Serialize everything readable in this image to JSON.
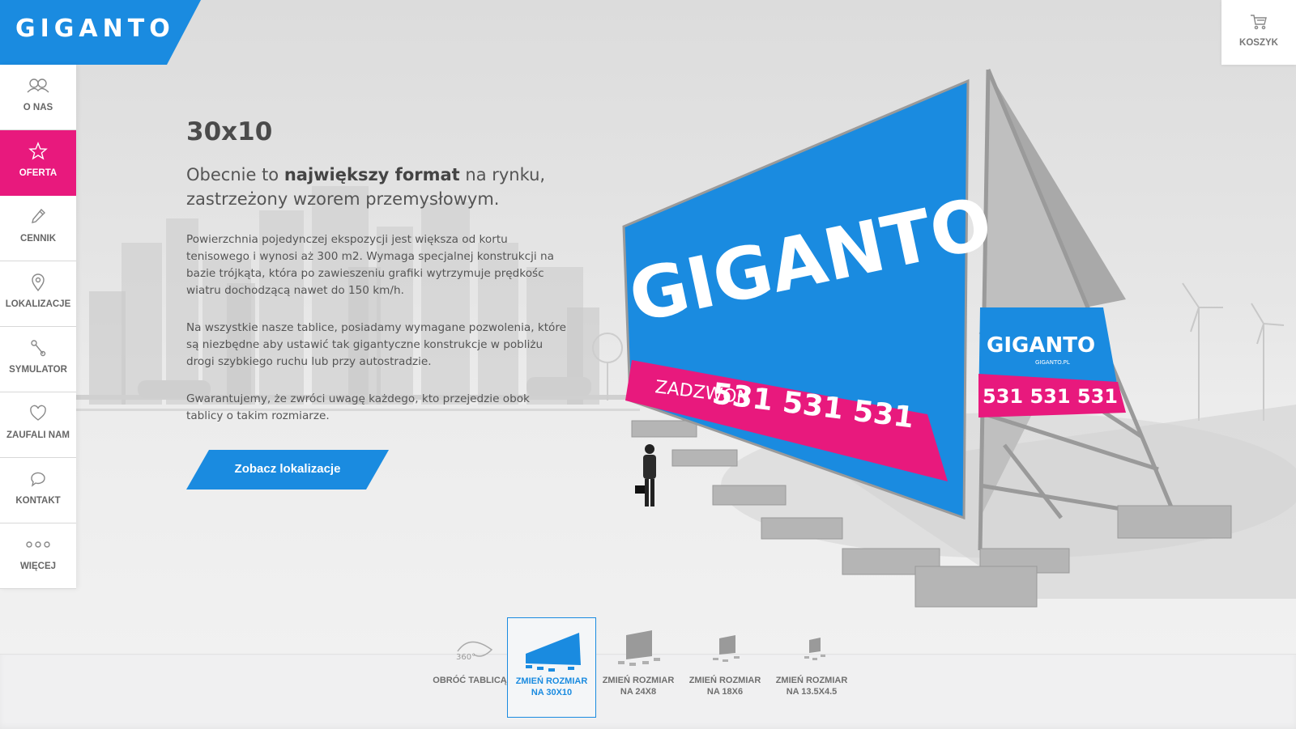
{
  "brand": {
    "logo": "GIGANTO",
    "colors": {
      "blue": "#1a8be0",
      "pink": "#e8197d"
    }
  },
  "sidebar": {
    "items": [
      {
        "label": "O NAS",
        "icon": "group-icon",
        "active": false
      },
      {
        "label": "OFERTA",
        "icon": "star-icon",
        "active": true
      },
      {
        "label": "CENNIK",
        "icon": "pen-icon",
        "active": false
      },
      {
        "label": "LOKALIZACJE",
        "icon": "location-pin-icon",
        "active": false
      },
      {
        "label": "SYMULATOR",
        "icon": "tools-icon",
        "active": false
      },
      {
        "label": "ZAUFALI NAM",
        "icon": "heart-icon",
        "active": false
      },
      {
        "label": "KONTAKT",
        "icon": "chat-bubble-icon",
        "active": false
      },
      {
        "label": "WIĘCEJ",
        "icon": "more-dots-icon",
        "active": false
      }
    ]
  },
  "cart": {
    "label": "KOSZYK",
    "icon": "cart-icon"
  },
  "main": {
    "title": "30x10",
    "lead_pre": "Obecnie to ",
    "lead_bold": "największy format",
    "lead_post": " na rynku, zastrzeżony wzorem przemysłowym.",
    "paragraphs": [
      "Powierzchnia pojedynczej ekspozycji jest większa od kortu tenisowego i wynosi aż 300 m2. Wymaga specjalnej konstrukcji na bazie trójkąta, która po zawieszeniu grafiki wytrzymuje prędkośc wiatru dochodzącą nawet do 150 km/h.",
      "Na wszystkie nasze tablice, posiadamy wymagane pozwolenia, które są niezbędne aby ustawić tak gigantyczne konstrukcje w pobliżu drogi szybkiego ruchu lub przy autostradzie.",
      "Gwarantujemy, że zwróci uwagę każdego, kto przejedzie obok tablicy o takim rozmiarze."
    ],
    "cta_label": "Zobacz lokalizacje"
  },
  "billboard": {
    "main_logo": "GIGANTO",
    "main_call_label": "ZADZWOŃ",
    "main_phone": "531 531 531",
    "side_logo": "GIGANTO",
    "side_url": "GIGANTO.PL",
    "side_phone": "531 531 531"
  },
  "tools": [
    {
      "line1": "OBRÓĆ TABLICĄ",
      "line2": "",
      "badge": "360°",
      "active": false
    },
    {
      "line1": "ZMIEŃ ROZMIAR",
      "line2": "NA 30X10",
      "active": true
    },
    {
      "line1": "ZMIEŃ ROZMIAR",
      "line2": "NA 24X8",
      "active": false
    },
    {
      "line1": "ZMIEŃ ROZMIAR",
      "line2": "NA 18X6",
      "active": false
    },
    {
      "line1": "ZMIEŃ ROZMIAR",
      "line2": "NA 13.5X4.5",
      "active": false
    }
  ]
}
